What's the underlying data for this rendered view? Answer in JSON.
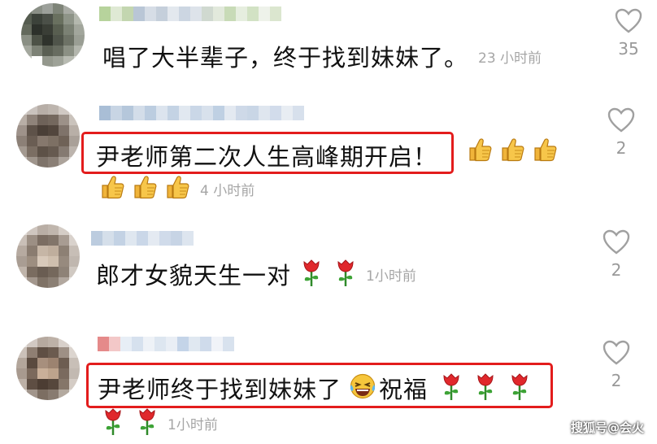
{
  "comments": [
    {
      "text": "唱了大半辈子，终于找到妹妹了。",
      "time": "23 小时前",
      "likes": "35",
      "highlighted": false,
      "emoji": []
    },
    {
      "text": "尹老师第二次人生高峰期开启！",
      "time": "4 小时前",
      "likes": "2",
      "highlighted": true,
      "emoji": [
        "thumbs-up",
        "thumbs-up",
        "thumbs-up",
        "thumbs-up",
        "thumbs-up",
        "thumbs-up"
      ]
    },
    {
      "text": "郎才女貌天生一对",
      "time": "1小时前",
      "likes": "2",
      "highlighted": false,
      "emoji": [
        "rose",
        "rose"
      ]
    },
    {
      "text": "尹老师终于找到妹妹了",
      "text2": "祝福",
      "time": "1小时前",
      "likes": "2",
      "highlighted": true,
      "emoji": [
        "laughing-face",
        "rose",
        "rose",
        "rose",
        "rose",
        "rose"
      ]
    }
  ],
  "watermark": "搜狐号@会火",
  "colors": {
    "highlight_border": "#e31c1c",
    "timestamp": "#a6a6a6",
    "like_icon": "#a0a0a0"
  }
}
